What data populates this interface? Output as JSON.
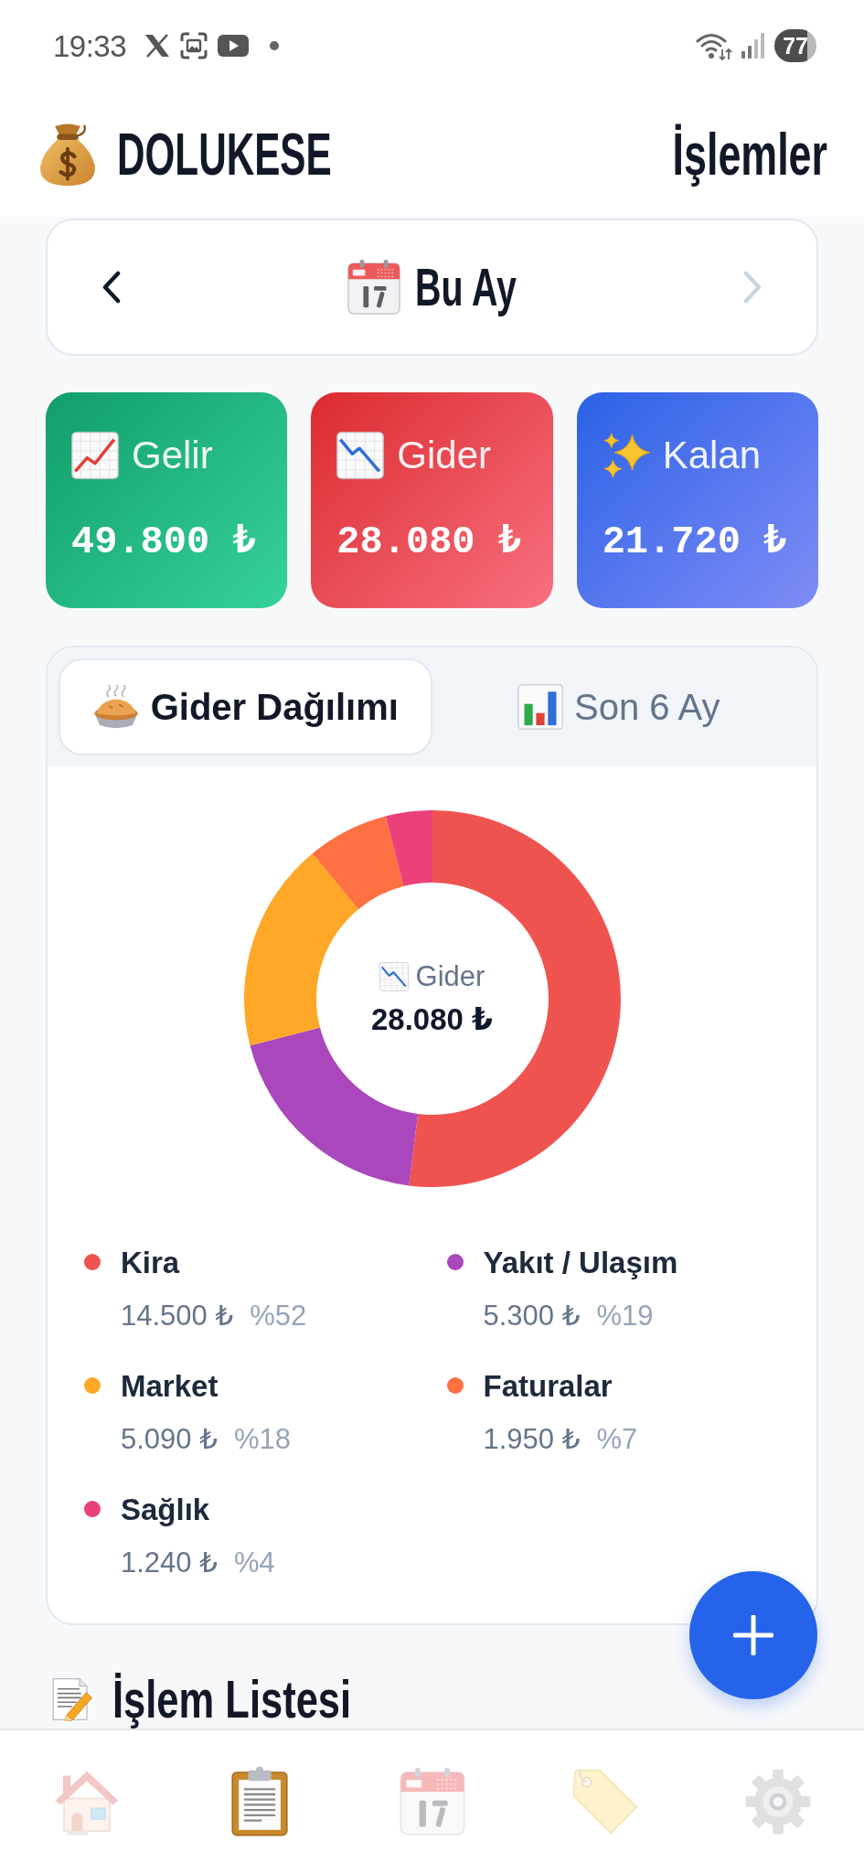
{
  "status_bar": {
    "time": "19:33",
    "battery": "77"
  },
  "header": {
    "app_title": "DOLUKESE",
    "page_title": "İşlemler"
  },
  "period": {
    "label": "Bu Ay",
    "prev": {
      "disabled": false
    },
    "next": {
      "disabled": true
    }
  },
  "summary": [
    {
      "kind": "income",
      "label": "Gelir",
      "amount": "49.800 ₺"
    },
    {
      "kind": "expense",
      "label": "Gider",
      "amount": "28.080 ₺"
    },
    {
      "kind": "balance",
      "label": "Kalan",
      "amount": "21.720 ₺"
    }
  ],
  "chart_tabs": [
    {
      "kind": "pie",
      "label": "Gider Dağılımı",
      "selected": true
    },
    {
      "kind": "bars",
      "label": "Son 6 Ay",
      "selected": false
    }
  ],
  "chart_panel": {
    "center": {
      "label": "Gider",
      "total": "28.080 ₺"
    },
    "chart_data": {
      "type": "donut",
      "categories": [
        "Kira",
        "Yakıt / Ulaşım",
        "Market",
        "Faturalar",
        "Sağlık"
      ],
      "values": [
        52,
        19,
        18,
        7,
        4
      ]
    },
    "legend": [
      {
        "color": "#ef5350",
        "amount": "14.500 ₺",
        "percent": "%52"
      },
      {
        "color": "#ab47bc",
        "amount": "5.300 ₺",
        "percent": "%19"
      },
      {
        "color": "#ffa726",
        "amount": "5.090 ₺",
        "percent": "%18"
      },
      {
        "color": "#ff7043",
        "amount": "1.950 ₺",
        "percent": "%7"
      },
      {
        "color": "#ec407a",
        "amount": "1.240 ₺",
        "percent": "%4"
      }
    ]
  },
  "section": {
    "title": "İşlem Listesi"
  },
  "nav": [
    {
      "kind": "house",
      "selected": false
    },
    {
      "kind": "clipboard",
      "selected": true
    },
    {
      "kind": "calendar",
      "selected": false
    },
    {
      "kind": "tag",
      "selected": false
    },
    {
      "kind": "gear",
      "selected": false
    }
  ]
}
